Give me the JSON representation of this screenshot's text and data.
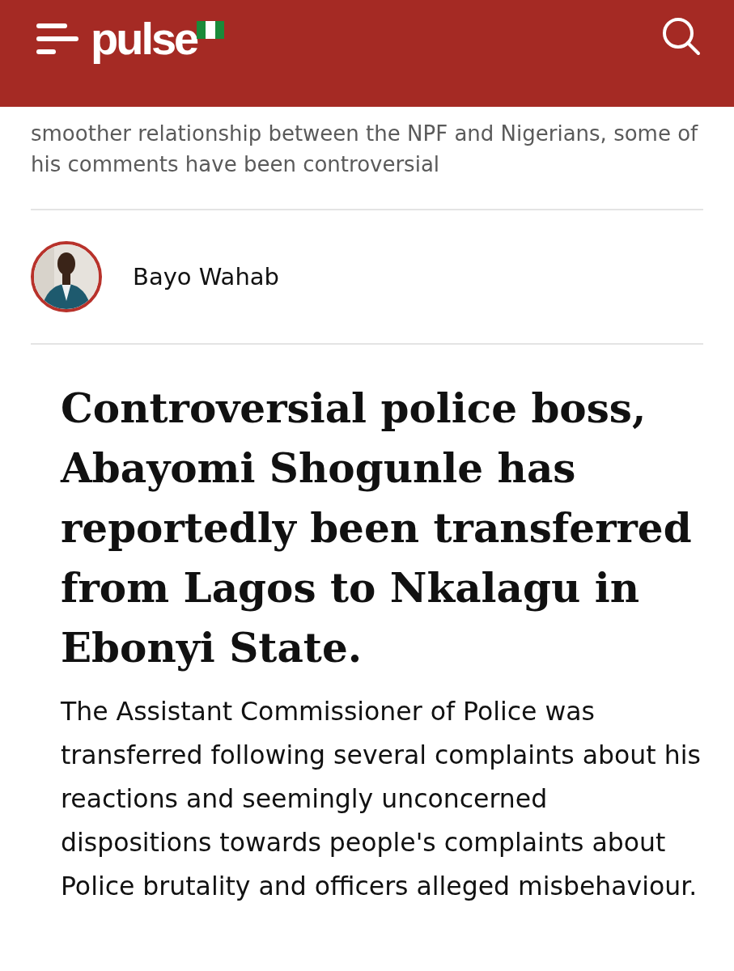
{
  "header": {
    "logo": "pulse"
  },
  "summary": {
    "text": "smoother relationship between the NPF and Nigerians, some of his comments have been controversial"
  },
  "author": {
    "name": "Bayo Wahab"
  },
  "headline": "Controversial police boss, Abayomi Shogunle has reportedly been transferred from Lagos to Nkalagu in Ebonyi State.",
  "body": "The Assistant Commissioner of Police was transferred following several complaints about his reactions and seemingly unconcerned dispositions towards people's complaints about Police brutality and officers alleged misbehaviour."
}
